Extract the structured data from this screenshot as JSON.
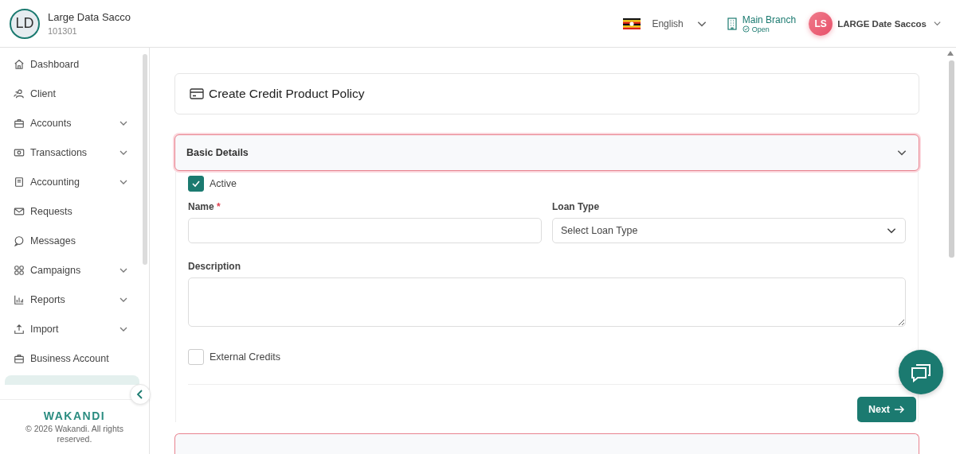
{
  "org": {
    "initials": "LD",
    "name": "Large Data Sacco",
    "code": "101301"
  },
  "topbar": {
    "language": "English",
    "branch": {
      "name": "Main Branch",
      "status": "Open"
    },
    "user": {
      "initials": "LS",
      "name": "LARGE Date Saccos"
    }
  },
  "sidebar": {
    "items": [
      {
        "label": "Dashboard",
        "kind": "home",
        "has_submenu": false
      },
      {
        "label": "Client",
        "kind": "users",
        "has_submenu": false
      },
      {
        "label": "Accounts",
        "kind": "briefcase",
        "has_submenu": true
      },
      {
        "label": "Transactions",
        "kind": "cash",
        "has_submenu": true
      },
      {
        "label": "Accounting",
        "kind": "book",
        "has_submenu": true
      },
      {
        "label": "Requests",
        "kind": "mail",
        "has_submenu": false
      },
      {
        "label": "Messages",
        "kind": "chat",
        "has_submenu": false
      },
      {
        "label": "Campaigns",
        "kind": "grid",
        "has_submenu": true
      },
      {
        "label": "Reports",
        "kind": "chart",
        "has_submenu": true
      },
      {
        "label": "Import",
        "kind": "upload",
        "has_submenu": true
      },
      {
        "label": "Business Account",
        "kind": "briefcase",
        "has_submenu": false
      }
    ],
    "brand": "WAKANDI",
    "copyright": "© 2026 Wakandi. All rights reserved."
  },
  "page": {
    "title": "Create Credit Product Policy"
  },
  "basic_details": {
    "title": "Basic Details",
    "active": {
      "label": "Active",
      "checked": true
    },
    "name": {
      "label": "Name",
      "required_mark": "*"
    },
    "loan_type": {
      "label": "Loan Type",
      "placeholder": "Select Loan Type"
    },
    "description": {
      "label": "Description"
    },
    "external_credits": {
      "label": "External Credits",
      "checked": false
    },
    "next_button": "Next"
  }
}
